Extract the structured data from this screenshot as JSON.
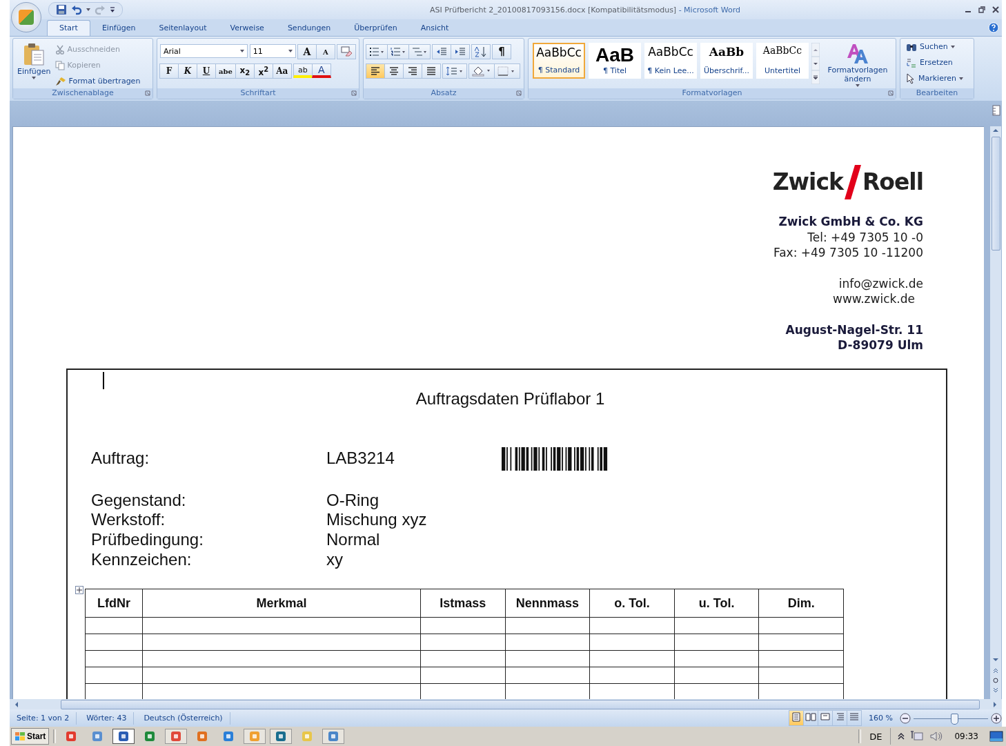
{
  "window": {
    "document_title": "ASI Prüfbericht 2_20100817093156.docx [Kompatibilitätsmodus]",
    "app_title": "- Microsoft Word"
  },
  "tabs": [
    {
      "label": "Start",
      "selected": true
    },
    {
      "label": "Einfügen",
      "selected": false
    },
    {
      "label": "Seitenlayout",
      "selected": false
    },
    {
      "label": "Verweise",
      "selected": false
    },
    {
      "label": "Sendungen",
      "selected": false
    },
    {
      "label": "Überprüfen",
      "selected": false
    },
    {
      "label": "Ansicht",
      "selected": false
    }
  ],
  "clipboard": {
    "group": "Zwischenablage",
    "paste": "Einfügen",
    "commands": [
      {
        "label": "Ausschneiden",
        "kind": "cut",
        "disabled": true
      },
      {
        "label": "Kopieren",
        "kind": "copy",
        "disabled": true
      },
      {
        "label": "Format übertragen",
        "kind": "brush",
        "disabled": false
      }
    ]
  },
  "font": {
    "group": "Schriftart",
    "family": "Arial",
    "size": "11",
    "grow": "A",
    "shrink": "A",
    "format_buttons": [
      "F",
      "K",
      "U",
      "abe",
      "x$_{2}$",
      "x$^{2}$",
      "Aa"
    ],
    "highlight": "ab",
    "color_button": "A"
  },
  "paragraph": {
    "group": "Absatz",
    "pilcrow": "¶",
    "alignments": [
      {
        "kind": "left",
        "selected": true
      },
      {
        "kind": "center",
        "selected": false
      },
      {
        "kind": "right",
        "selected": false
      },
      {
        "kind": "justify",
        "selected": false
      }
    ]
  },
  "styles": {
    "group": "Formatvorlagen",
    "items": [
      {
        "sample": "AaBbCc",
        "name": "¶ Standard",
        "kind": "normal",
        "selected": true
      },
      {
        "sample": "AaB",
        "name": "¶ Titel",
        "kind": "title",
        "selected": false
      },
      {
        "sample": "AaBbCc",
        "name": "¶ Kein Lee...",
        "kind": "normal",
        "selected": false
      },
      {
        "sample": "AaBb",
        "name": "Überschrif...",
        "kind": "heading",
        "selected": false
      },
      {
        "sample": "AaBbCc",
        "name": "Untertitel",
        "kind": "subtitle",
        "selected": false
      }
    ],
    "change": "Formatvorlagen ändern"
  },
  "editing": {
    "group": "Bearbeiten",
    "commands": [
      {
        "label": "Suchen",
        "kind": "find"
      },
      {
        "label": "Ersetzen",
        "kind": "replace"
      },
      {
        "label": "Markieren",
        "kind": "select"
      }
    ]
  },
  "letterhead": {
    "brand_left": "Zwick",
    "brand_right": "Roell",
    "company": "Zwick GmbH & Co. KG",
    "phone": "Tel: +49 7305 10 -0",
    "fax": "Fax: +49 7305 10 -11200",
    "email": "info@zwick.de",
    "web": "www.zwick.de",
    "street": "August-Nagel-Str. 11",
    "city": "D-89079 Ulm"
  },
  "order_sheet": {
    "title": "Auftragsdaten Prüflabor 1",
    "order": {
      "label": "Auftrag:",
      "value": "LAB3214"
    },
    "fields": [
      {
        "label": "Gegenstand:",
        "value": "O-Ring"
      },
      {
        "label": "Werkstoff:",
        "value": "Mischung xyz"
      },
      {
        "label": "Prüfbedingung:",
        "value": "Normal"
      },
      {
        "label": "Kennzeichen:",
        "value": "xy"
      }
    ],
    "table": {
      "columns": [
        "LfdNr",
        "Merkmal",
        "Istmass",
        "Nennmass",
        "o. Tol.",
        "u. Tol.",
        "Dim."
      ]
    }
  },
  "status_bar": {
    "items": [
      "Seite: 1 von 2",
      "Wörter: 43",
      "Deutsch (Österreich)"
    ],
    "views": [
      {
        "kind": "print",
        "selected": true
      },
      {
        "kind": "reading",
        "selected": false
      },
      {
        "kind": "web",
        "selected": false
      },
      {
        "kind": "outline",
        "selected": false
      },
      {
        "kind": "draft",
        "selected": false
      }
    ],
    "zoom": "160 %",
    "zoom_slider": {
      "level": 0.55
    }
  },
  "taskbar": {
    "start": "Start",
    "apps": [
      {
        "kind": "photos",
        "open": false,
        "selected": false
      },
      {
        "kind": "disc",
        "open": false,
        "selected": false
      },
      {
        "kind": "word",
        "open": true,
        "selected": true
      },
      {
        "kind": "excel",
        "open": false,
        "selected": false
      },
      {
        "kind": "slides",
        "open": true,
        "selected": false
      },
      {
        "kind": "fox",
        "open": false,
        "selected": false
      },
      {
        "kind": "globe",
        "open": false,
        "selected": false
      },
      {
        "kind": "clock",
        "open": true,
        "selected": false
      },
      {
        "kind": "figure",
        "open": true,
        "selected": false
      },
      {
        "kind": "folder",
        "open": false,
        "selected": false
      },
      {
        "kind": "cubes",
        "open": true,
        "selected": false
      }
    ],
    "language": "DE",
    "clock": "09:33"
  }
}
